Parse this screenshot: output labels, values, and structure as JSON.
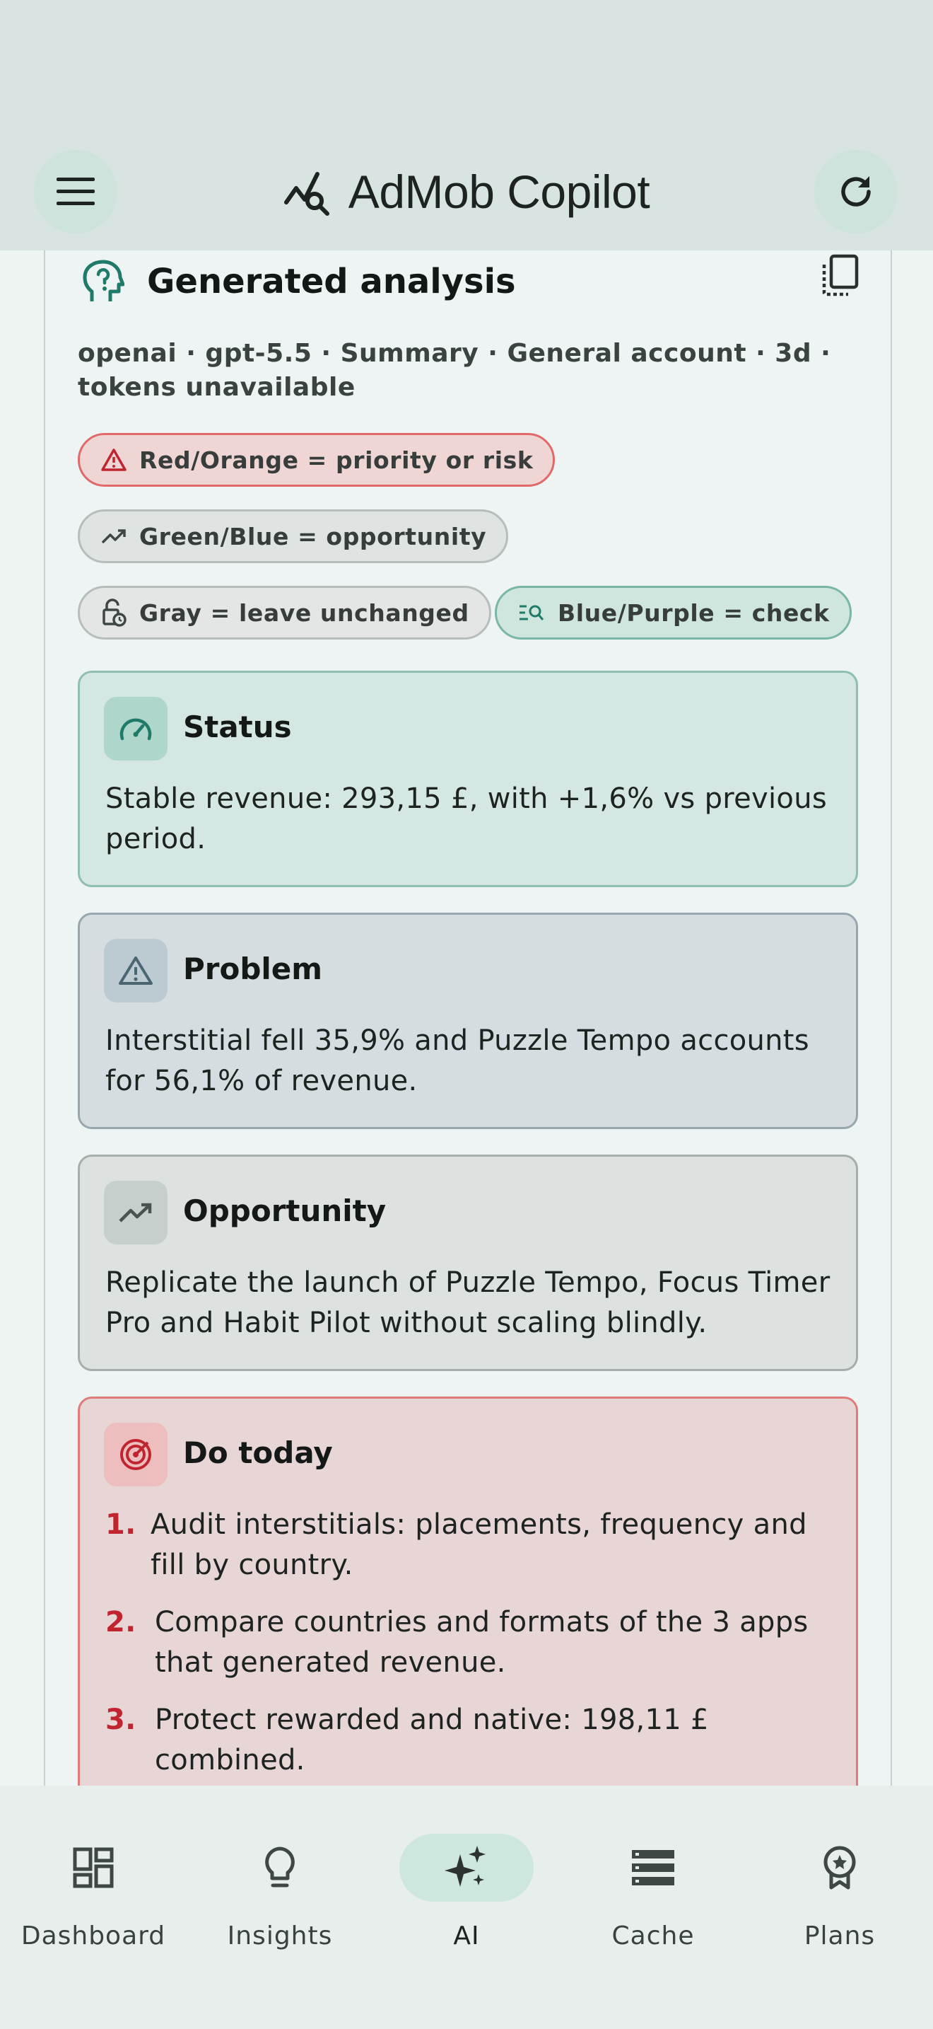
{
  "app": {
    "title": "AdMob Copilot"
  },
  "card": {
    "title": "Generated analysis",
    "meta": "openai · gpt-5.5 · Summary · General account · 3d · tokens unavailable"
  },
  "legend": {
    "red": "Red/Orange = priority or risk",
    "green": "Green/Blue = opportunity",
    "gray": "Gray = leave unchanged",
    "blue": "Blue/Purple = check"
  },
  "sections": {
    "status": {
      "title": "Status",
      "text": "Stable revenue: 293,15 £, with +1,6% vs previous period."
    },
    "problem": {
      "title": "Problem",
      "text": "Interstitial fell 35,9% and Puzzle Tempo accounts for 56,1% of revenue."
    },
    "opportunity": {
      "title": "Opportunity",
      "text": "Replicate the launch of Puzzle Tempo, Focus Timer Pro and Habit Pilot without scaling blindly."
    },
    "today": {
      "title": "Do today",
      "items": [
        {
          "num": "1.",
          "text": "Audit interstitials: placements, frequency and fill by country."
        },
        {
          "num": "2.",
          "text": "Compare countries and formats of the 3 apps that generated revenue."
        },
        {
          "num": "3.",
          "text": "Protect rewarded and native: 198,11 £ combined."
        }
      ]
    }
  },
  "nav": {
    "items": [
      {
        "label": "Dashboard",
        "icon": "dashboard-icon"
      },
      {
        "label": "Insights",
        "icon": "lightbulb-icon"
      },
      {
        "label": "AI",
        "icon": "sparkle-icon",
        "active": true
      },
      {
        "label": "Cache",
        "icon": "storage-icon"
      },
      {
        "label": "Plans",
        "icon": "badge-icon"
      }
    ]
  },
  "colors": {
    "accent": "#1f7a68",
    "risk": "#c0242f",
    "topbar": "#d8e4e1",
    "nav_active": "#cde7df"
  }
}
